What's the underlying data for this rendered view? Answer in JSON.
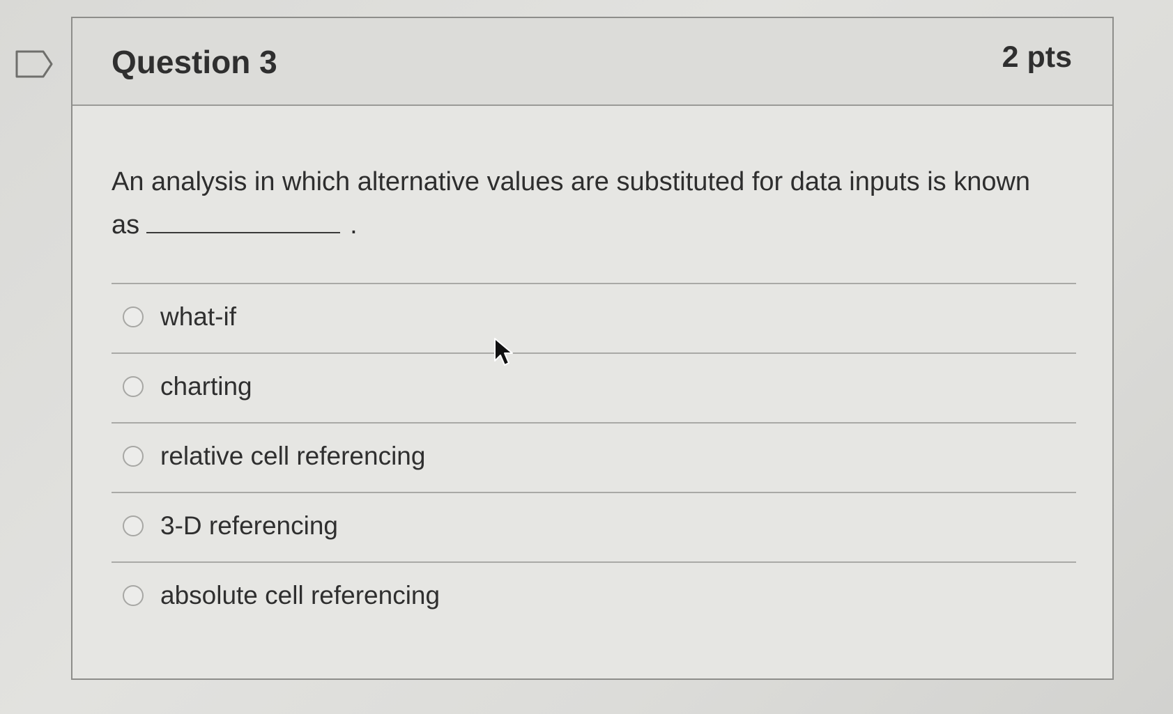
{
  "question": {
    "title": "Question 3",
    "points": "2 pts",
    "text_before_blank": "An analysis in which alternative values are substituted for data inputs is known as",
    "text_after_blank": "."
  },
  "answers": [
    {
      "label": "what-if",
      "selected": false
    },
    {
      "label": "charting",
      "selected": false
    },
    {
      "label": "relative cell referencing",
      "selected": false
    },
    {
      "label": "3-D referencing",
      "selected": false
    },
    {
      "label": "absolute cell referencing",
      "selected": false
    }
  ],
  "icons": {
    "flag": "bookmark-flag-icon",
    "cursor": "mouse-pointer-icon",
    "radio": "radio-button-icon"
  },
  "colors": {
    "text": "#2f2f2f",
    "border": "#8d8d8a",
    "header_background": "#dcdcd9"
  }
}
